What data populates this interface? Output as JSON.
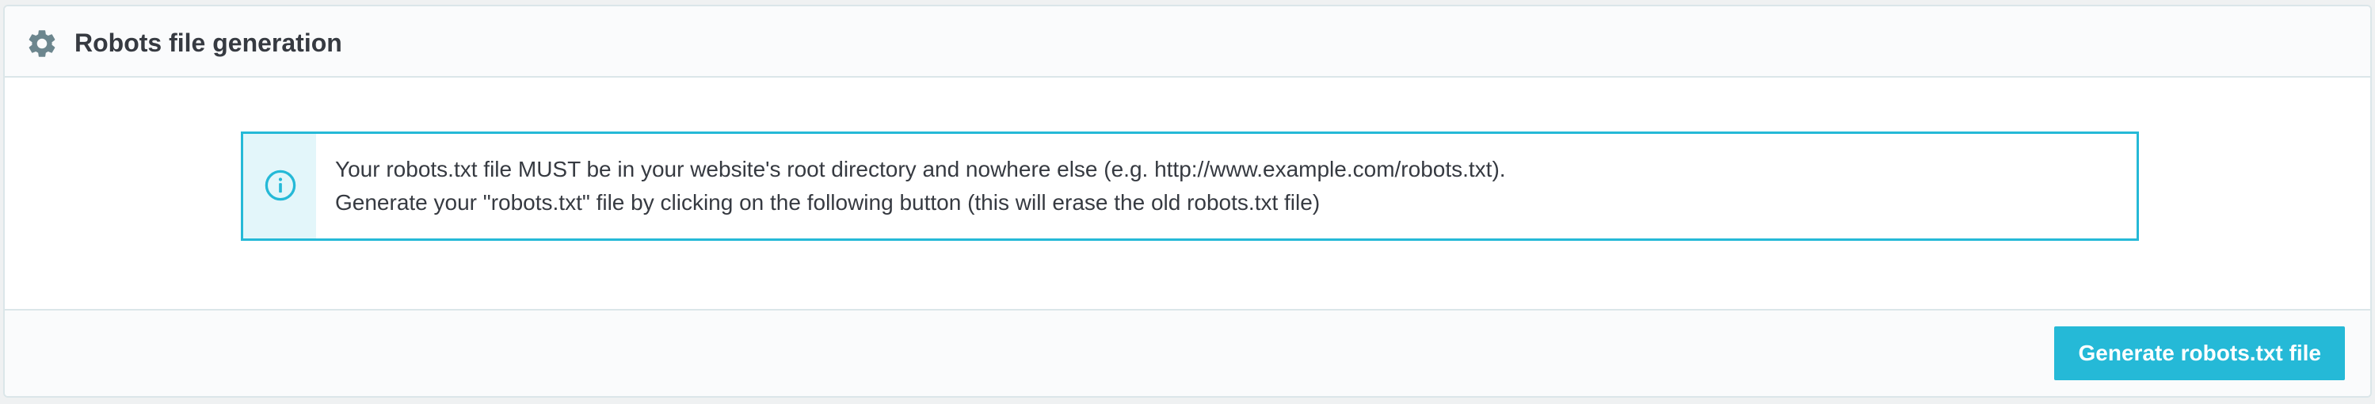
{
  "panel": {
    "title": "Robots file generation",
    "header_icon": "gear-icon"
  },
  "alert": {
    "icon": "info-icon",
    "line1": "Your robots.txt file MUST be in your website's root directory and nowhere else (e.g. http://www.example.com/robots.txt).",
    "line2": "Generate your \"robots.txt\" file by clicking on the following button (this will erase the old robots.txt file)"
  },
  "footer": {
    "generate_label": "Generate robots.txt file"
  },
  "colors": {
    "accent": "#25b9d7",
    "alert_bg": "#e3f6fa",
    "text": "#363a41",
    "icon_gray": "#6c868e"
  }
}
